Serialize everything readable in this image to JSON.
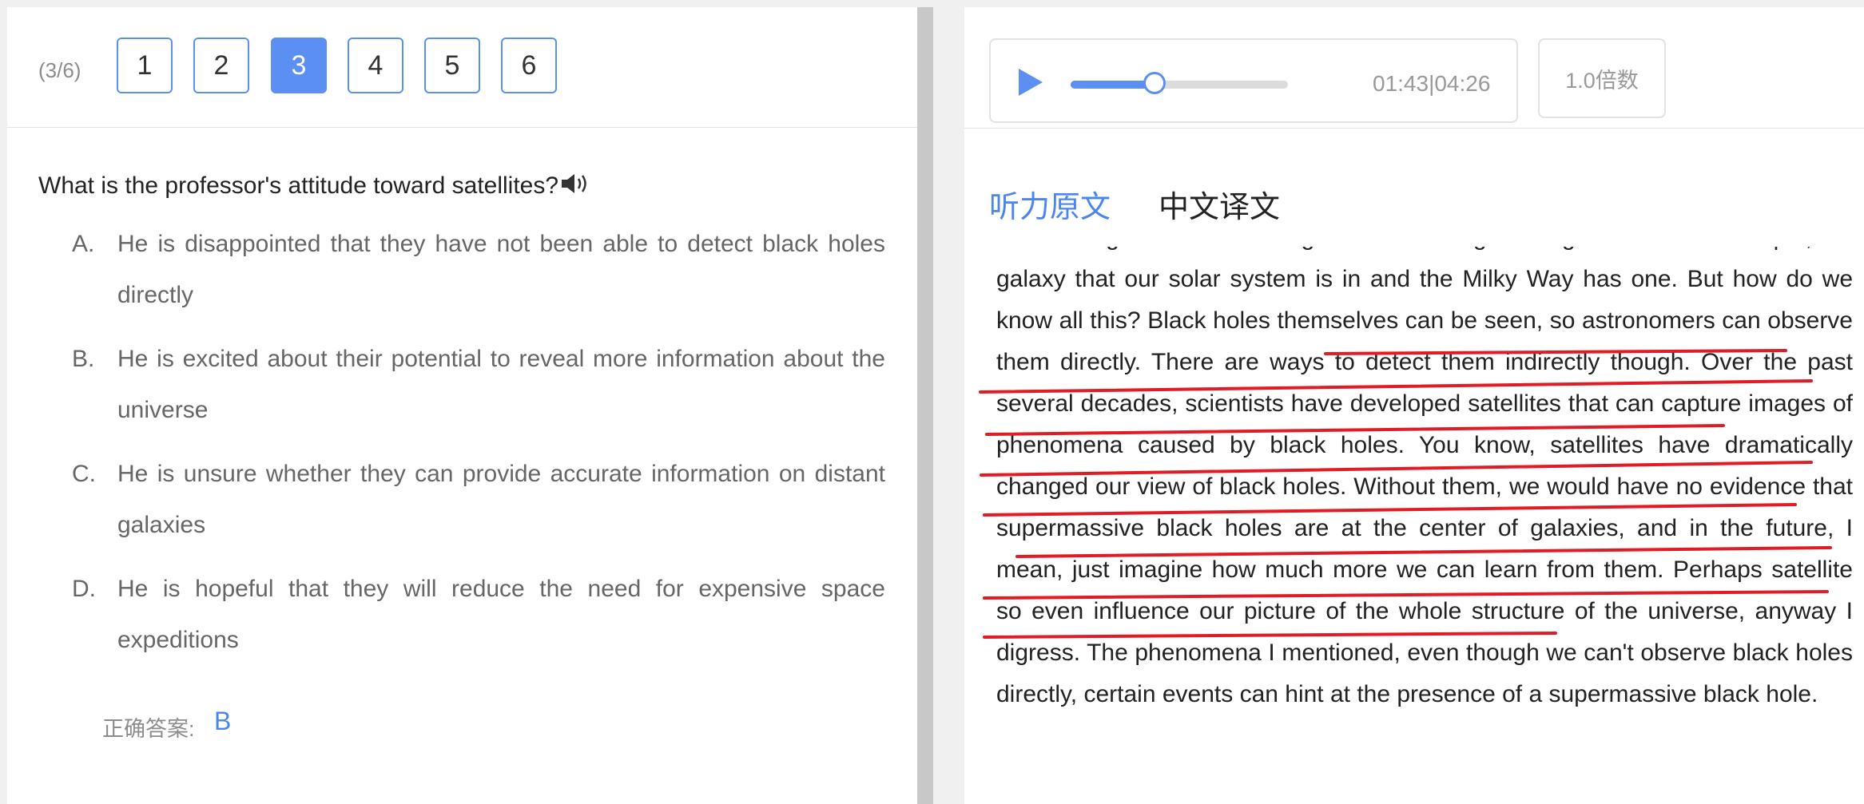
{
  "question_nav": {
    "progress": "(3/6)",
    "buttons": [
      "1",
      "2",
      "3",
      "4",
      "5",
      "6"
    ],
    "active": "3"
  },
  "question": {
    "text": "What is the professor's attitude toward satellites?",
    "audio_icon": "speaker-icon"
  },
  "options": [
    {
      "letter": "A.",
      "text": "He is disappointed that they have not been able to detect black holes directly"
    },
    {
      "letter": "B.",
      "text": "He is excited about their potential to reveal more information about the universe"
    },
    {
      "letter": "C.",
      "text": "He is unsure whether they can provide accurate information on distant galaxies"
    },
    {
      "letter": "D.",
      "text": "He is hopeful that they will reduce the need for expensive space expeditions"
    }
  ],
  "answer": {
    "label": "正确答案:",
    "value": "B"
  },
  "player": {
    "play_icon": "play-icon",
    "time": "01:43|04:26",
    "progress_fraction": 0.387,
    "speed_label": "1.0倍数"
  },
  "tabs": [
    {
      "label": "听力原文",
      "active": true
    },
    {
      "label": "中文译文",
      "active": false
    }
  ],
  "transcript": "well. Though that's something that's still being investigated. But for example, the galaxy that our solar system is in and the Milky Way has one. But how do we know all this? Black holes themselves can be seen, so astronomers can observe them directly. There are ways to detect them indirectly though. Over the past several decades, scientists have developed satellites that can capture images of phenomena caused by black holes. You know, satellites have dramatically changed our view of black holes. Without them, we would have no evidence that supermassive black holes are at the center of galaxies, and in the future, I mean, just imagine how much more we can learn from them. Perhaps satellite so even influence our picture of the whole structure of the universe, anyway I digress. The phenomena I mentioned, even though we can't observe black holes directly, certain events can hint at the presence of a supermassive black hole.",
  "colors": {
    "accent": "#5b8ff1",
    "link": "#4a85f0",
    "annotation": "#e01d24"
  }
}
